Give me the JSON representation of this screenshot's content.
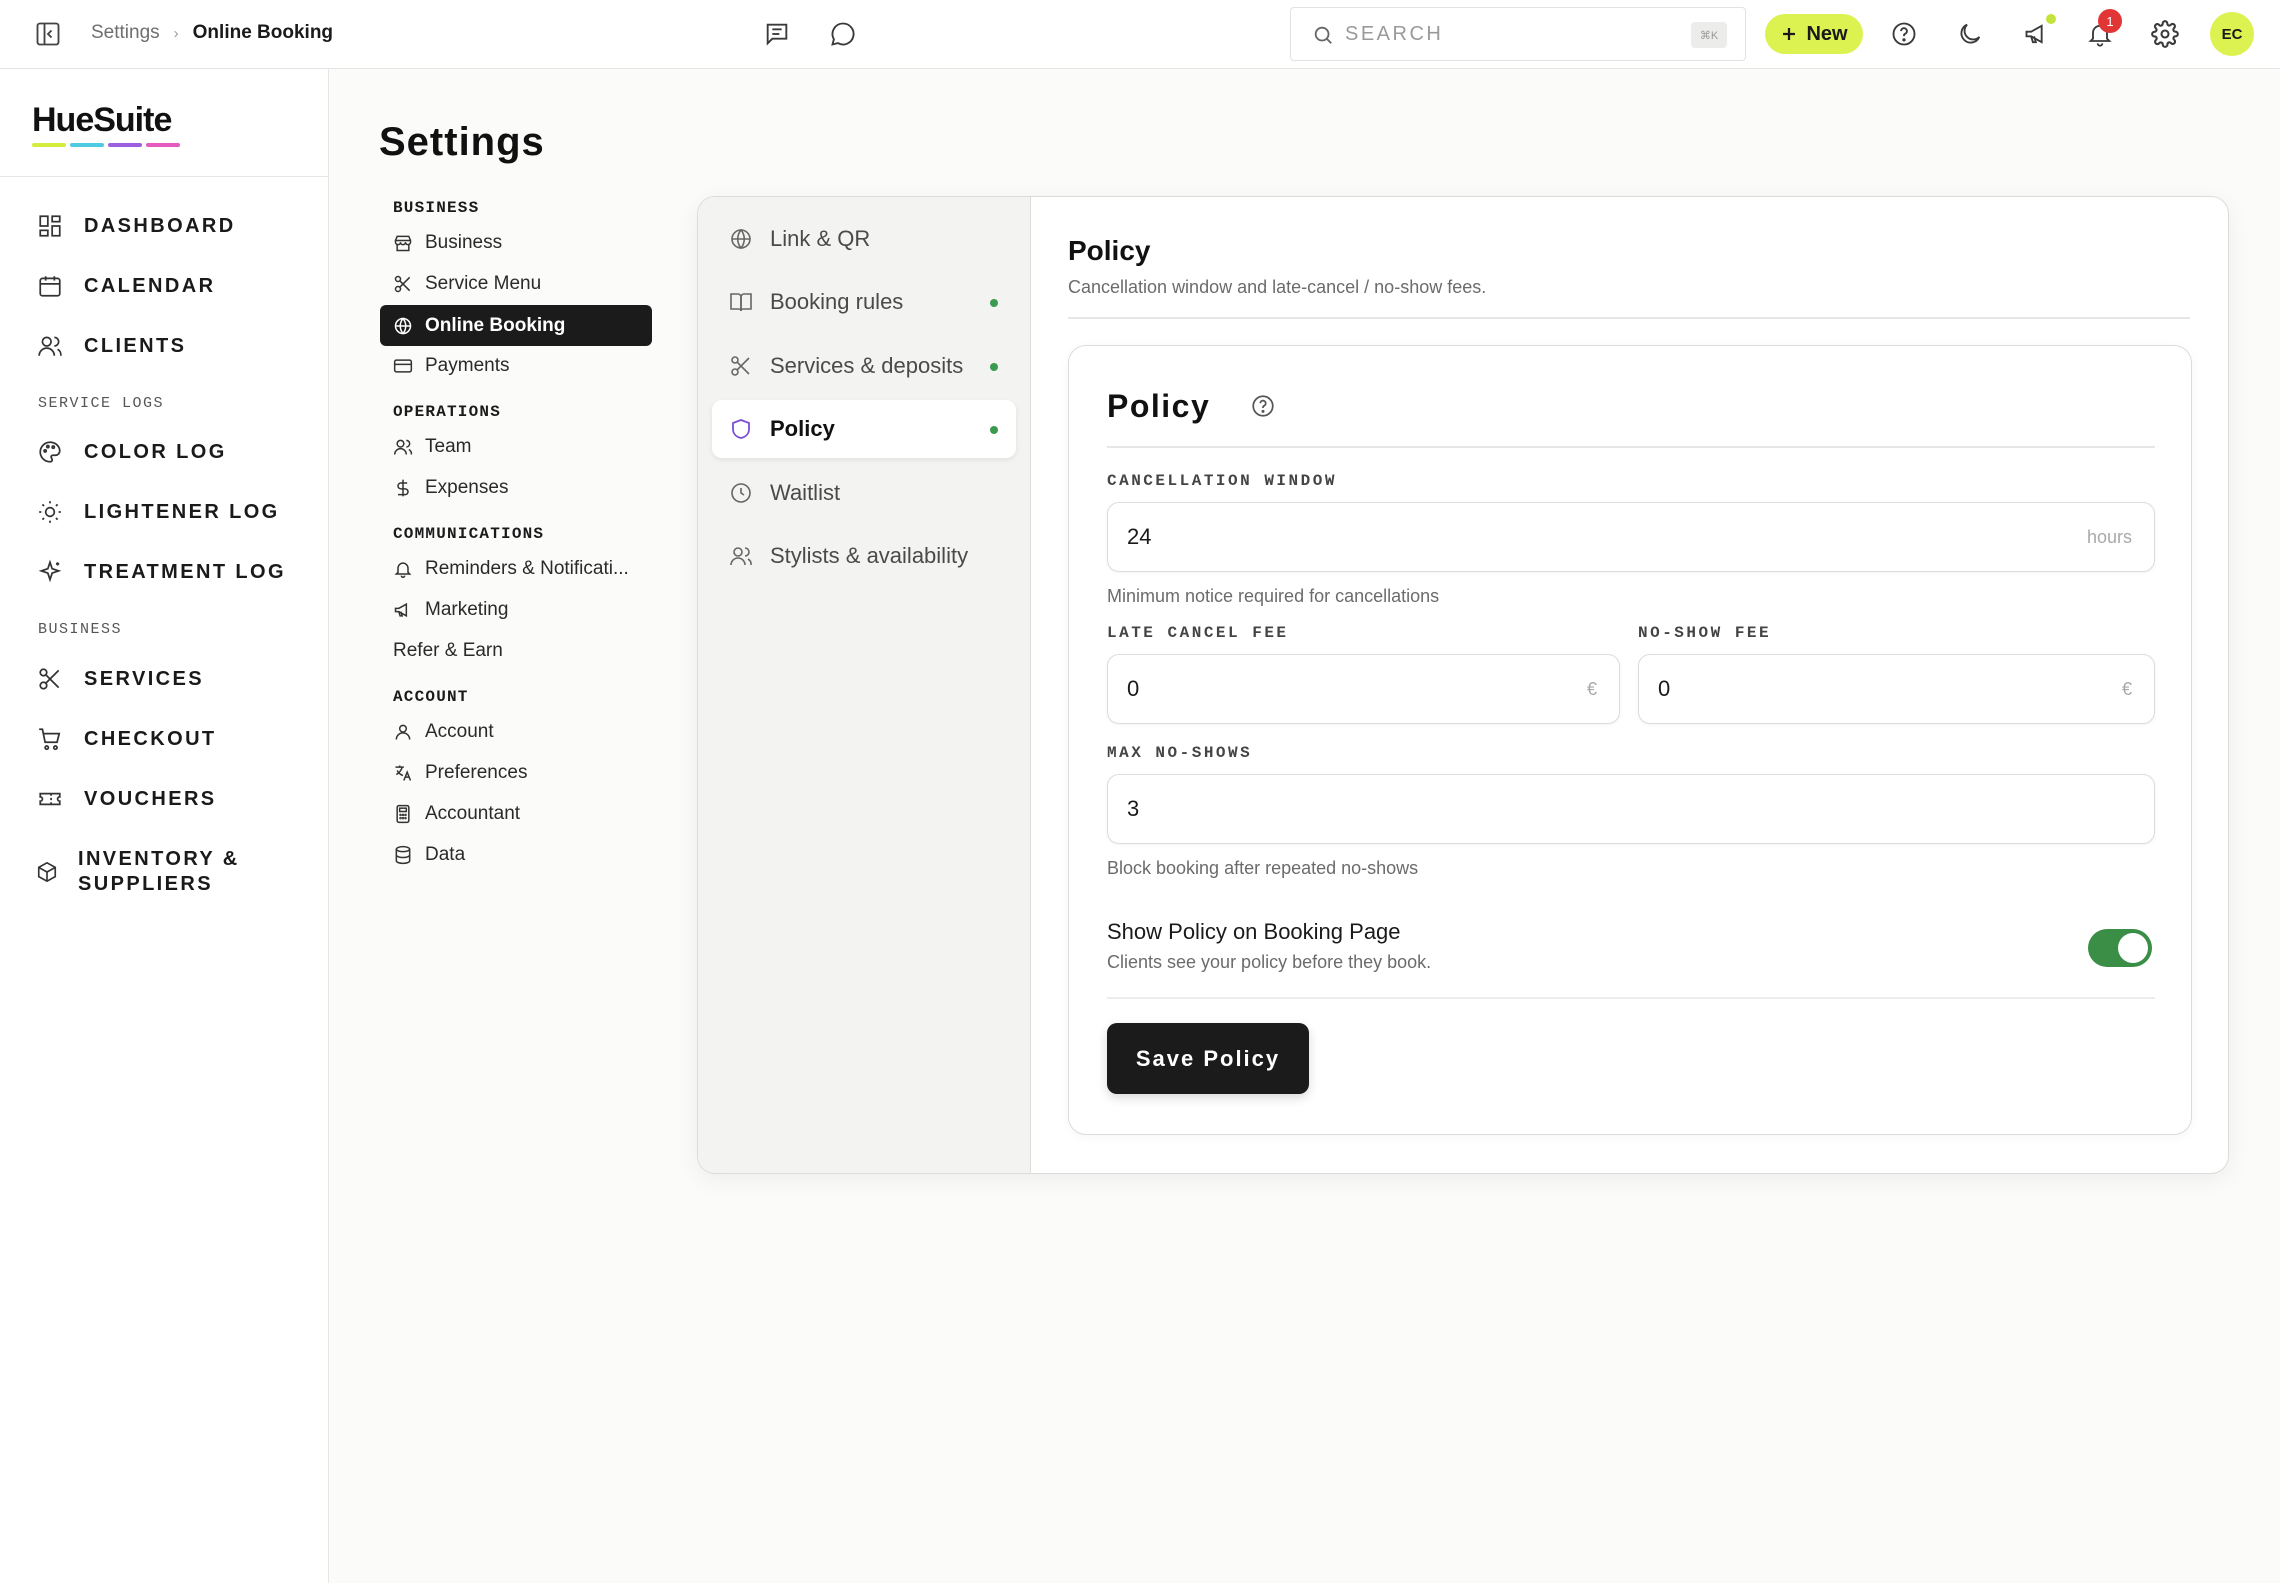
{
  "breadcrumb": {
    "parent": "Settings",
    "separator": "›",
    "current": "Online Booking"
  },
  "search": {
    "placeholder": "SEARCH",
    "shortcut": "⌘K"
  },
  "topbar": {
    "new_label": "New",
    "notification_count": "1",
    "avatar_initials": "EC"
  },
  "brand": {
    "name": "HueSuite",
    "colors": [
      "#d4ec3c",
      "#4ecbe0",
      "#9d5fe0",
      "#e65ac0"
    ]
  },
  "sidebar": {
    "items": [
      {
        "label": "DASHBOARD",
        "icon": "dashboard-icon"
      },
      {
        "label": "CALENDAR",
        "icon": "calendar-icon"
      },
      {
        "label": "CLIENTS",
        "icon": "users-icon"
      }
    ],
    "section_service_logs": "SERVICE LOGS",
    "logs": [
      {
        "label": "COLOR LOG",
        "icon": "palette-icon"
      },
      {
        "label": "LIGHTENER LOG",
        "icon": "sun-icon"
      },
      {
        "label": "TREATMENT LOG",
        "icon": "sparkle-icon"
      }
    ],
    "section_business": "BUSINESS",
    "business": [
      {
        "label": "SERVICES",
        "icon": "scissors-icon"
      },
      {
        "label": "CHECKOUT",
        "icon": "cart-icon"
      },
      {
        "label": "VOUCHERS",
        "icon": "ticket-icon"
      },
      {
        "label": "INVENTORY &",
        "label2": "SUPPLIERS",
        "icon": "box-icon"
      }
    ]
  },
  "settings": {
    "title": "Settings",
    "sections": {
      "business": "BUSINESS",
      "operations": "OPERATIONS",
      "communications": "COMMUNICATIONS",
      "account": "ACCOUNT"
    },
    "items": {
      "business": "Business",
      "service_menu": "Service Menu",
      "online_booking": "Online Booking",
      "payments": "Payments",
      "team": "Team",
      "expenses": "Expenses",
      "reminders": "Reminders & Notificati...",
      "marketing": "Marketing",
      "refer": "Refer & Earn",
      "account": "Account",
      "preferences": "Preferences",
      "accountant": "Accountant",
      "data": "Data"
    }
  },
  "subnav": [
    {
      "label": "Link & QR",
      "icon": "globe-icon",
      "status": false
    },
    {
      "label": "Booking rules",
      "icon": "book-icon",
      "status": true
    },
    {
      "label": "Services & deposits",
      "icon": "scissors-icon",
      "status": true
    },
    {
      "label": "Policy",
      "icon": "shield-icon",
      "status": true,
      "active": true
    },
    {
      "label": "Waitlist",
      "icon": "clock-icon",
      "status": false
    },
    {
      "label": "Stylists & availability",
      "icon": "users-icon",
      "status": false
    }
  ],
  "policy": {
    "header_title": "Policy",
    "header_sub": "Cancellation window and late-cancel / no-show fees.",
    "card_title": "Policy",
    "cancellation_label": "CANCELLATION WINDOW",
    "cancellation_value": "24",
    "cancellation_suffix": "hours",
    "cancellation_help": "Minimum notice required for cancellations",
    "late_fee_label": "LATE CANCEL FEE",
    "late_fee_value": "0",
    "no_show_label": "NO-SHOW FEE",
    "no_show_value": "0",
    "currency": "€",
    "max_no_shows_label": "MAX NO-SHOWS",
    "max_no_shows_value": "3",
    "max_no_shows_help": "Block booking after repeated no-shows",
    "toggle_label": "Show Policy on Booking Page",
    "toggle_sub": "Clients see your policy before they book.",
    "toggle_on": true,
    "save_label": "Save Policy"
  },
  "colors": {
    "accent": "#dcf251",
    "toggle_on": "#3b8e45",
    "status_dot": "#3c9a4f",
    "active_icon": "#7a4fd6"
  }
}
